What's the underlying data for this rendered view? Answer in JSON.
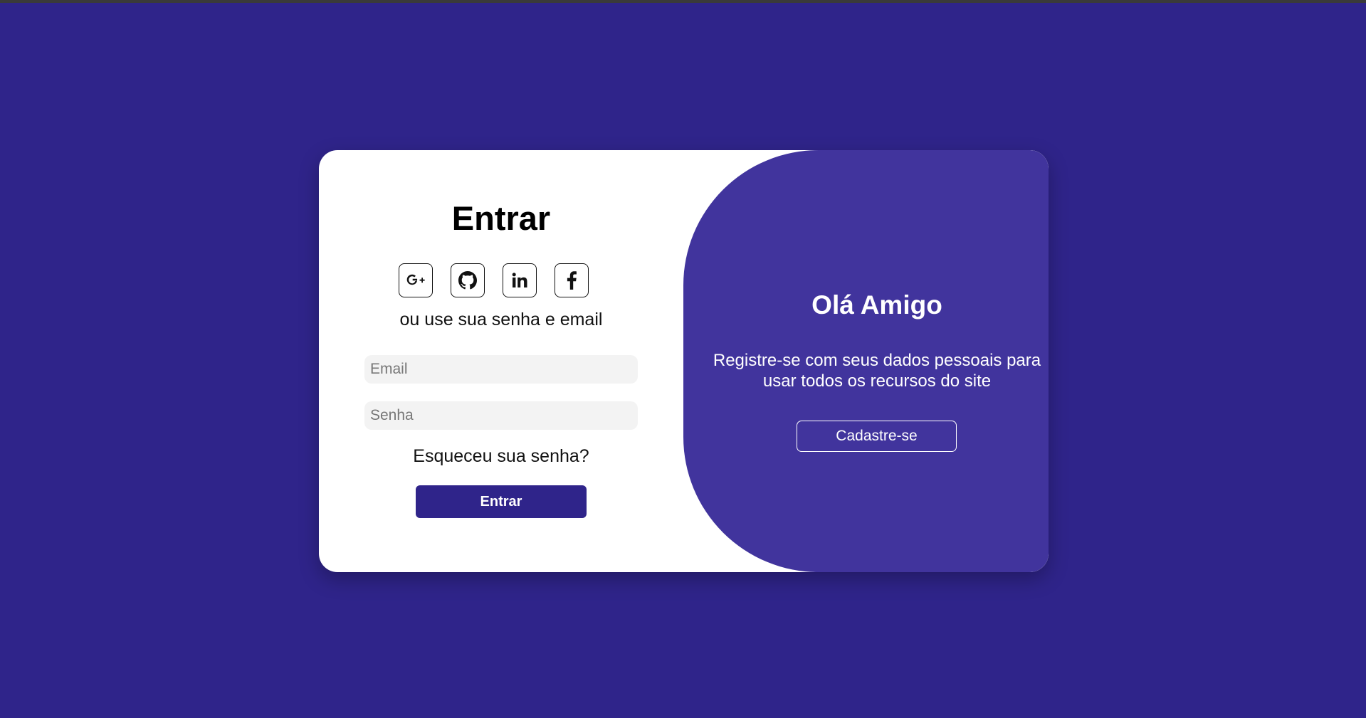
{
  "login": {
    "title": "Entrar",
    "social_icons": [
      "google-plus-icon",
      "github-icon",
      "linkedin-icon",
      "facebook-icon"
    ],
    "divider_text": "ou use sua senha e email",
    "email_placeholder": "Email",
    "password_placeholder": "Senha",
    "forgot_link": "Esqueceu sua senha?",
    "submit_label": "Entrar"
  },
  "overlay": {
    "title": "Olá Amigo",
    "text_line1": "Registre-se com seus dados pessoais para",
    "text_line2": "usar todos os recursos do site",
    "signup_label": "Cadastre-se"
  },
  "colors": {
    "background": "#2f248a",
    "overlay": "#41349d",
    "primary_button": "#2f248a",
    "card": "#ffffff"
  }
}
